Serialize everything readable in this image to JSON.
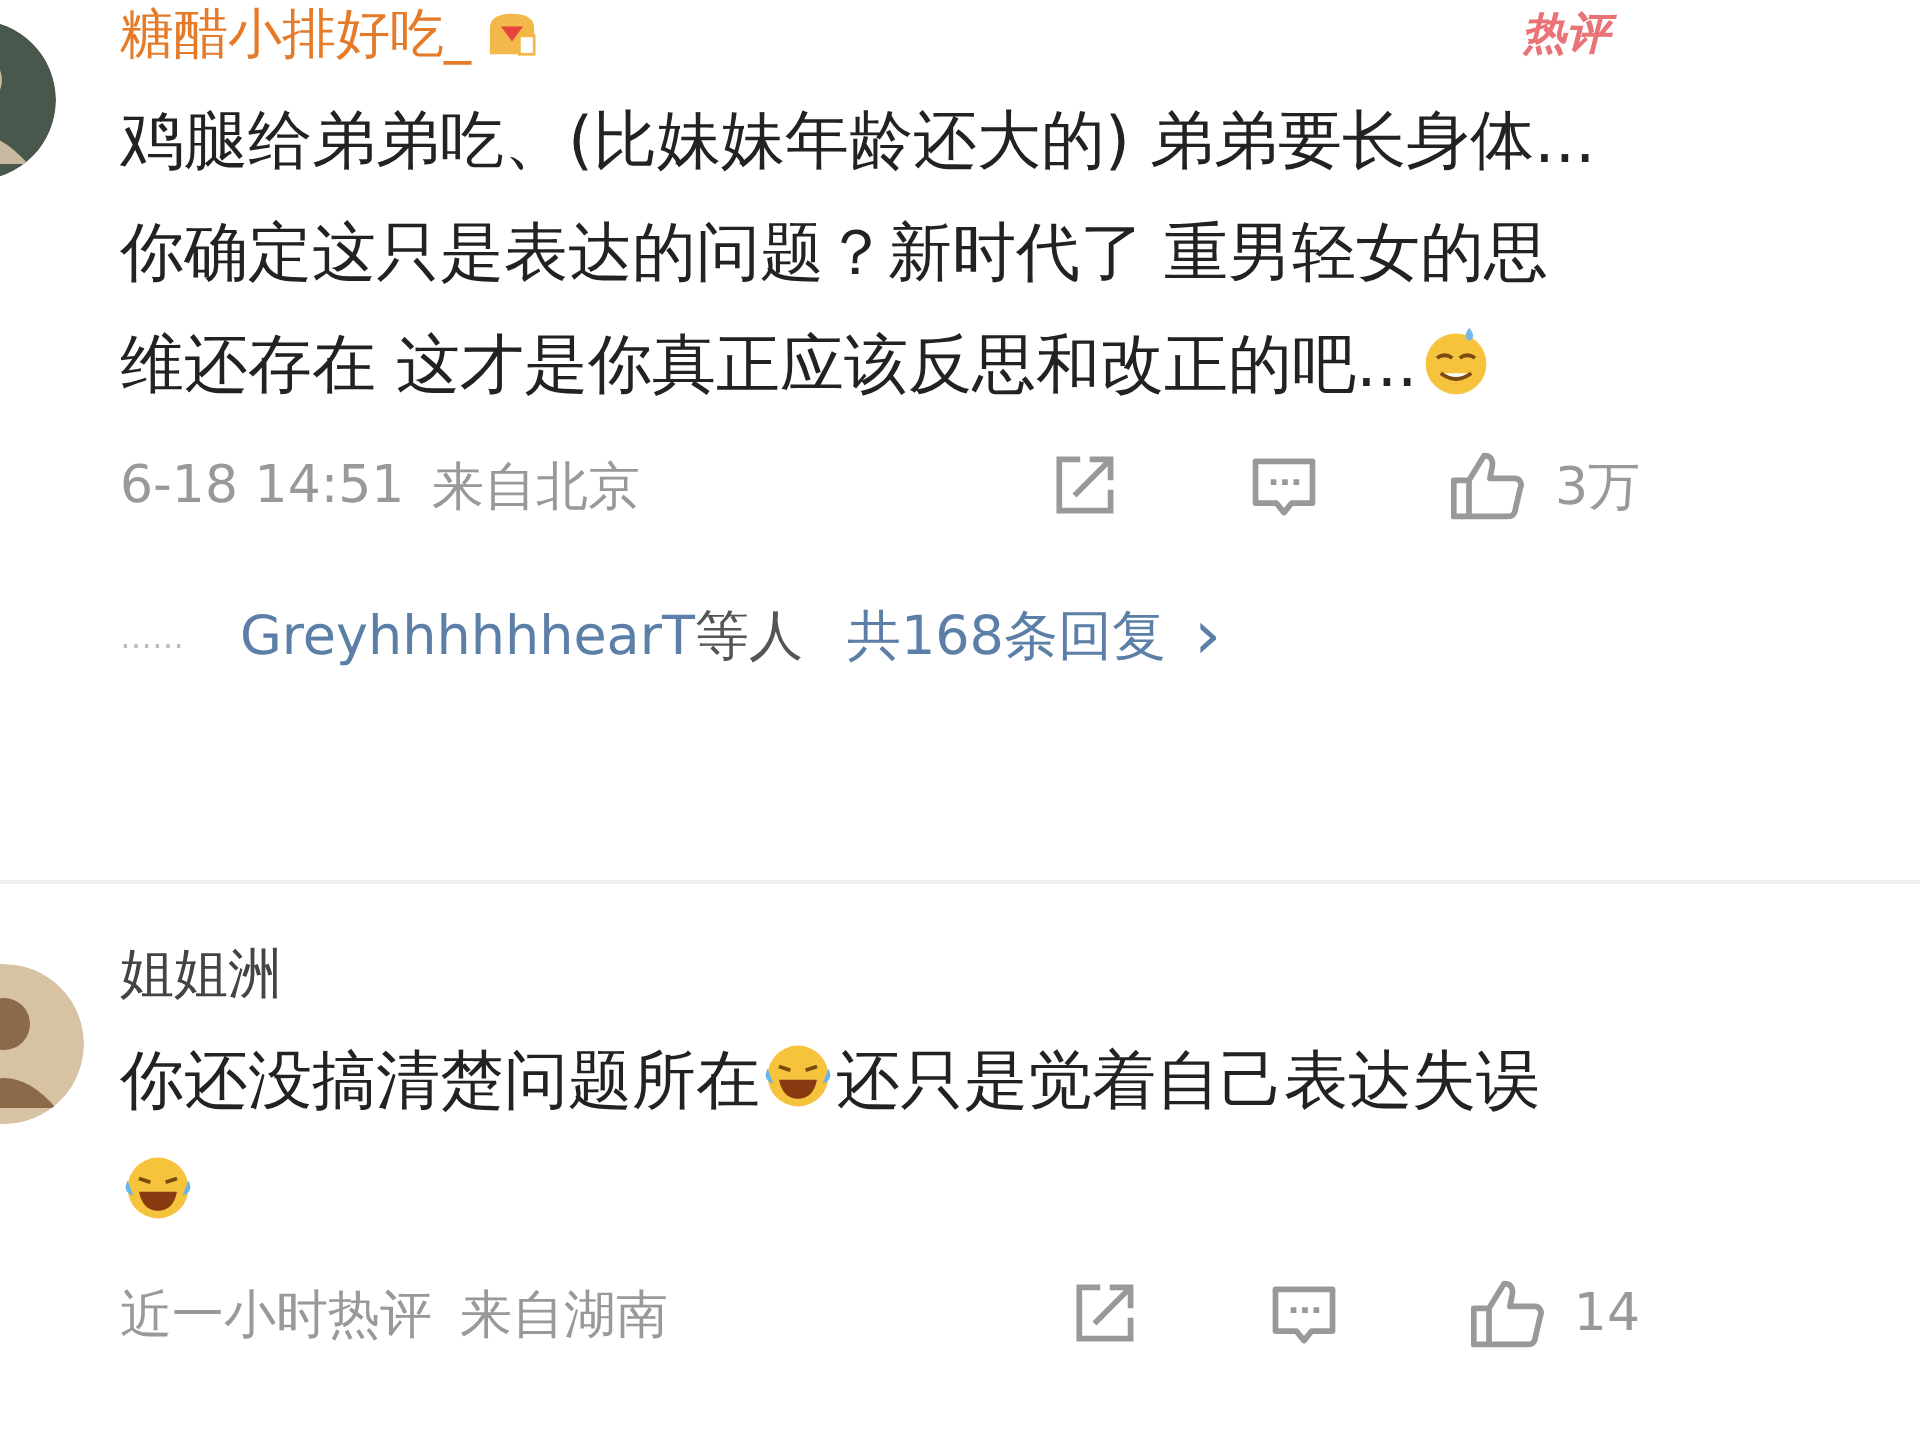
{
  "comments": [
    {
      "author": "糖醋小排好吃_",
      "color": "#e57a28",
      "medal": true,
      "badge": "热评",
      "text": [
        {
          "kind": "text",
          "s": "鸡腿给弟弟吃、(比妹妹年龄还大的) 弟弟要长身体...你确定这只是表达的问题？新时代了 重男轻女的思维还存在 这才是你真正应该反思和改正的吧..."
        },
        {
          "kind": "sweat"
        }
      ],
      "time": "6-18 14:51",
      "location": "来自北京",
      "likes": "3万",
      "replies": {
        "dots": "……",
        "who": "GreyhhhhhhearT",
        "suffix": "等人",
        "count": "共168条回复",
        "arrow": "›"
      }
    },
    {
      "author": "姐姐洲",
      "color": "#444444",
      "medal": false,
      "text": [
        {
          "kind": "text",
          "s": "你还没搞清楚问题所在"
        },
        {
          "kind": "laugh"
        },
        {
          "kind": "text",
          "s": "还只是觉着自己表达失误"
        },
        {
          "kind": "laugh"
        }
      ],
      "time": "近一小时热评",
      "location": "来自湖南",
      "likes": "14"
    }
  ]
}
